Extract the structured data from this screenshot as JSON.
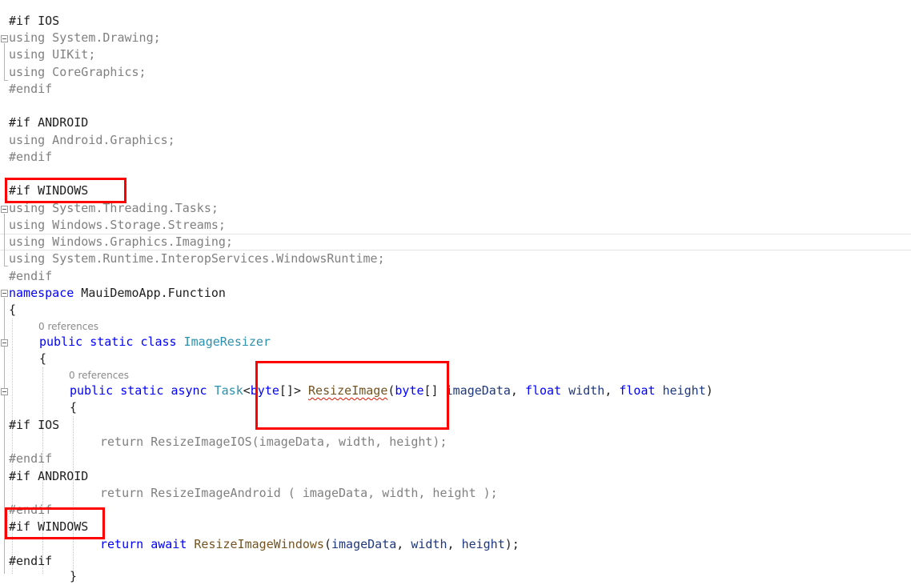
{
  "code": {
    "l1": "#if IOS",
    "l2_kw": "using",
    "l2_rest": " System.Drawing;",
    "l3_kw": "using",
    "l3_rest": " UIKit;",
    "l4_kw": "using",
    "l4_rest": " CoreGraphics;",
    "l5": "#endif",
    "l7": "#if ANDROID",
    "l8_kw": "using",
    "l8_rest": " Android.Graphics;",
    "l9": "#endif",
    "l11": "#if WINDOWS",
    "l12_kw": "using",
    "l12_rest": " System.Threading.Tasks;",
    "l13_kw": "using",
    "l13_rest": " Windows.Storage.Streams;",
    "l14_kw": "using",
    "l14_rest": " Windows.Graphics.Imaging;",
    "l15_kw": "using",
    "l15_rest": " System.Runtime.InteropServices.WindowsRuntime;",
    "l16": "#endif",
    "l17_kw": "namespace",
    "l17_rest": " MauiDemoApp.Function",
    "l18": "{",
    "lens1": "0 references",
    "l19_kw1": "public",
    "l19_kw2": "static",
    "l19_kw3": "class",
    "l19_type": "ImageResizer",
    "l20": "{",
    "lens2": "0 references",
    "l21_kw1": "public",
    "l21_kw2": "static",
    "l21_kw3": "async",
    "l21_type": "Task",
    "l21_lt": "<",
    "l21_byte1": "byte",
    "l21_br1": "[]>",
    "l21_method": "ResizeImage",
    "l21_paren": "(",
    "l21_byte2": "byte",
    "l21_br2": "[]",
    "l21_p1": "imageData",
    "l21_comma1": ", ",
    "l21_float1": "float",
    "l21_p2": "width",
    "l21_comma2": ", ",
    "l21_float2": "float",
    "l21_p3": "height",
    "l21_close": ")",
    "l22": "{",
    "l23": "#if IOS",
    "l24": "return ResizeImageIOS(imageData, width, height);",
    "l25": "#endif",
    "l26": "#if ANDROID",
    "l27": "return ResizeImageAndroid ( imageData, width, height );",
    "l28": "#endif",
    "l29": "#if WINDOWS",
    "l30_kw1": "return",
    "l30_kw2": "await",
    "l30_method": "ResizeImageWindows",
    "l30_args_open": "(",
    "l30_a1": "imageData",
    "l30_c1": ", ",
    "l30_a2": "width",
    "l30_c2": ", ",
    "l30_a3": "height",
    "l30_end": ");",
    "l31": "#endif",
    "l32": "}"
  },
  "colors": {
    "keyword": "#0000ff",
    "type": "#2b91af",
    "method": "#74531f",
    "inactive_code": "#808080",
    "highlight_box": "#ff0000"
  }
}
